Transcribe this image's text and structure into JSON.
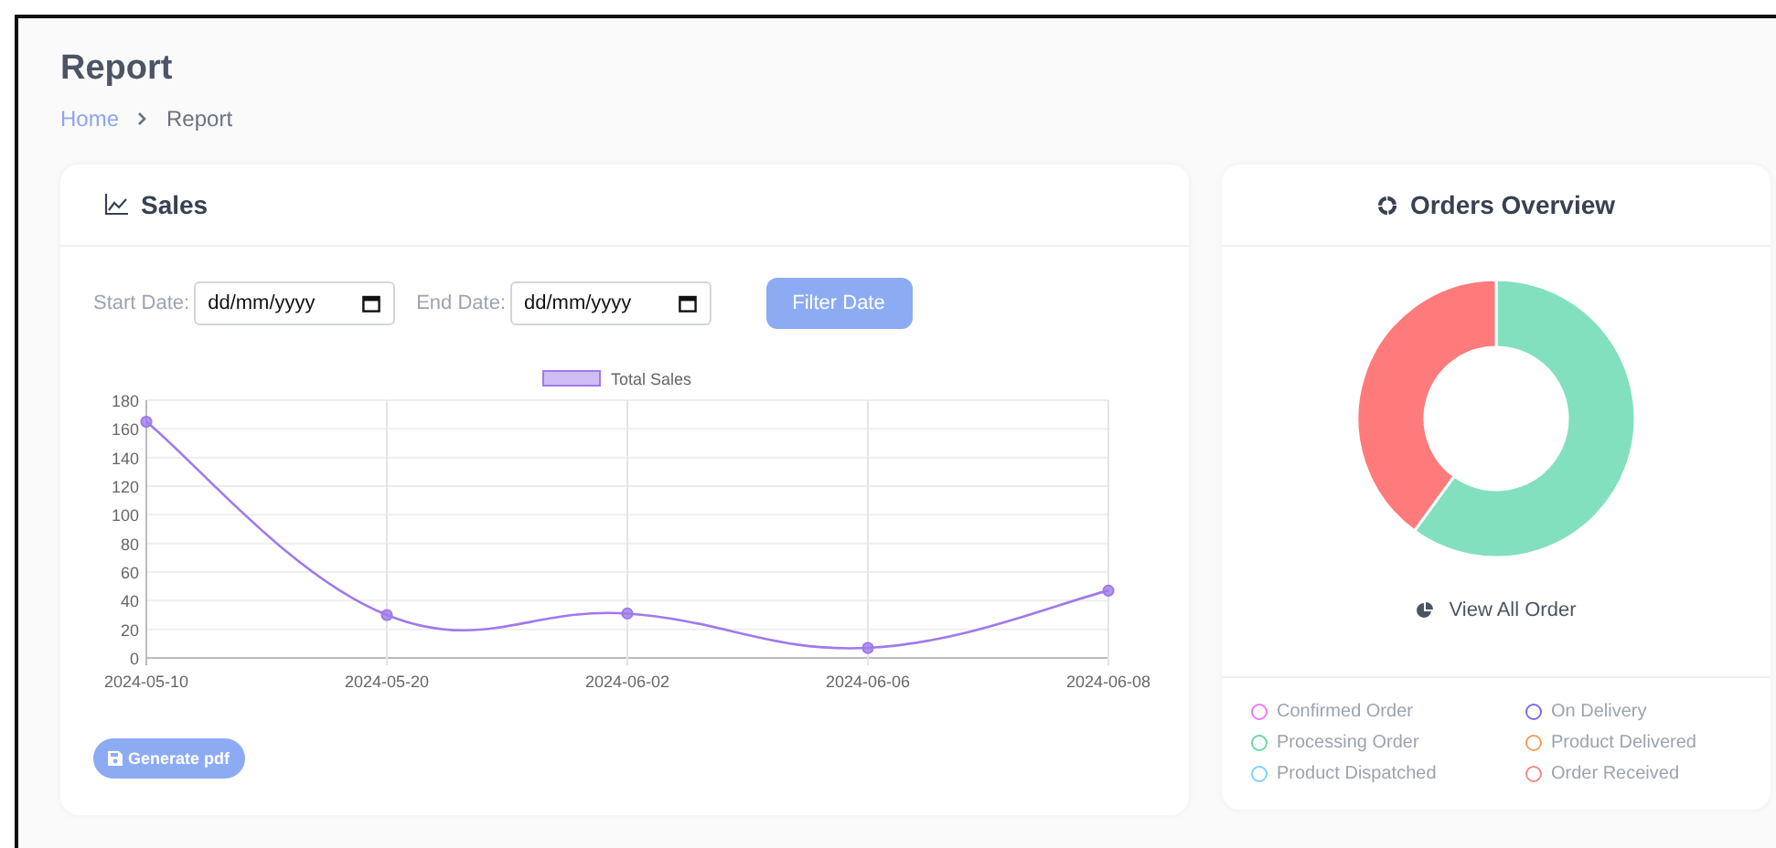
{
  "page": {
    "title": "Report"
  },
  "breadcrumb": [
    {
      "label": "Home",
      "kind": "link"
    },
    {
      "label": "Report",
      "kind": "current"
    }
  ],
  "sales": {
    "title": "Sales",
    "filters": [
      {
        "label": "Start Date:",
        "placeholder": "dd/mm/yyyy"
      },
      {
        "label": "End Date:",
        "placeholder": "dd/mm/yyyy"
      }
    ],
    "filter_button": "Filter Date",
    "chart_data": {
      "type": "line",
      "categories": [
        "2024-05-10",
        "2024-05-20",
        "2024-06-02",
        "2024-06-06",
        "2024-06-08"
      ],
      "series": [
        {
          "name": "Total Sales",
          "color": "#9f7aea",
          "marker": "circle",
          "values": [
            165,
            30,
            31,
            7,
            47
          ]
        }
      ],
      "grid": true,
      "ylim": [
        0,
        180
      ],
      "yticks": [
        0,
        20,
        40,
        60,
        80,
        100,
        120,
        140,
        160,
        180
      ]
    },
    "pdf_button": "Generate pdf"
  },
  "orders": {
    "title": "Orders Overview",
    "view_all": "View All Order",
    "legend": [
      {
        "label": "Confirmed Order",
        "color": "#e879f9"
      },
      {
        "label": "On Delivery",
        "color": "#7c6cf0"
      },
      {
        "label": "Processing Order",
        "color": "#6ed6a8"
      },
      {
        "label": "Product Delivered",
        "color": "#f59e5b"
      },
      {
        "label": "Product Dispatched",
        "color": "#7dd3fc"
      },
      {
        "label": "Order Received",
        "color": "#f58a8a"
      }
    ]
  }
}
